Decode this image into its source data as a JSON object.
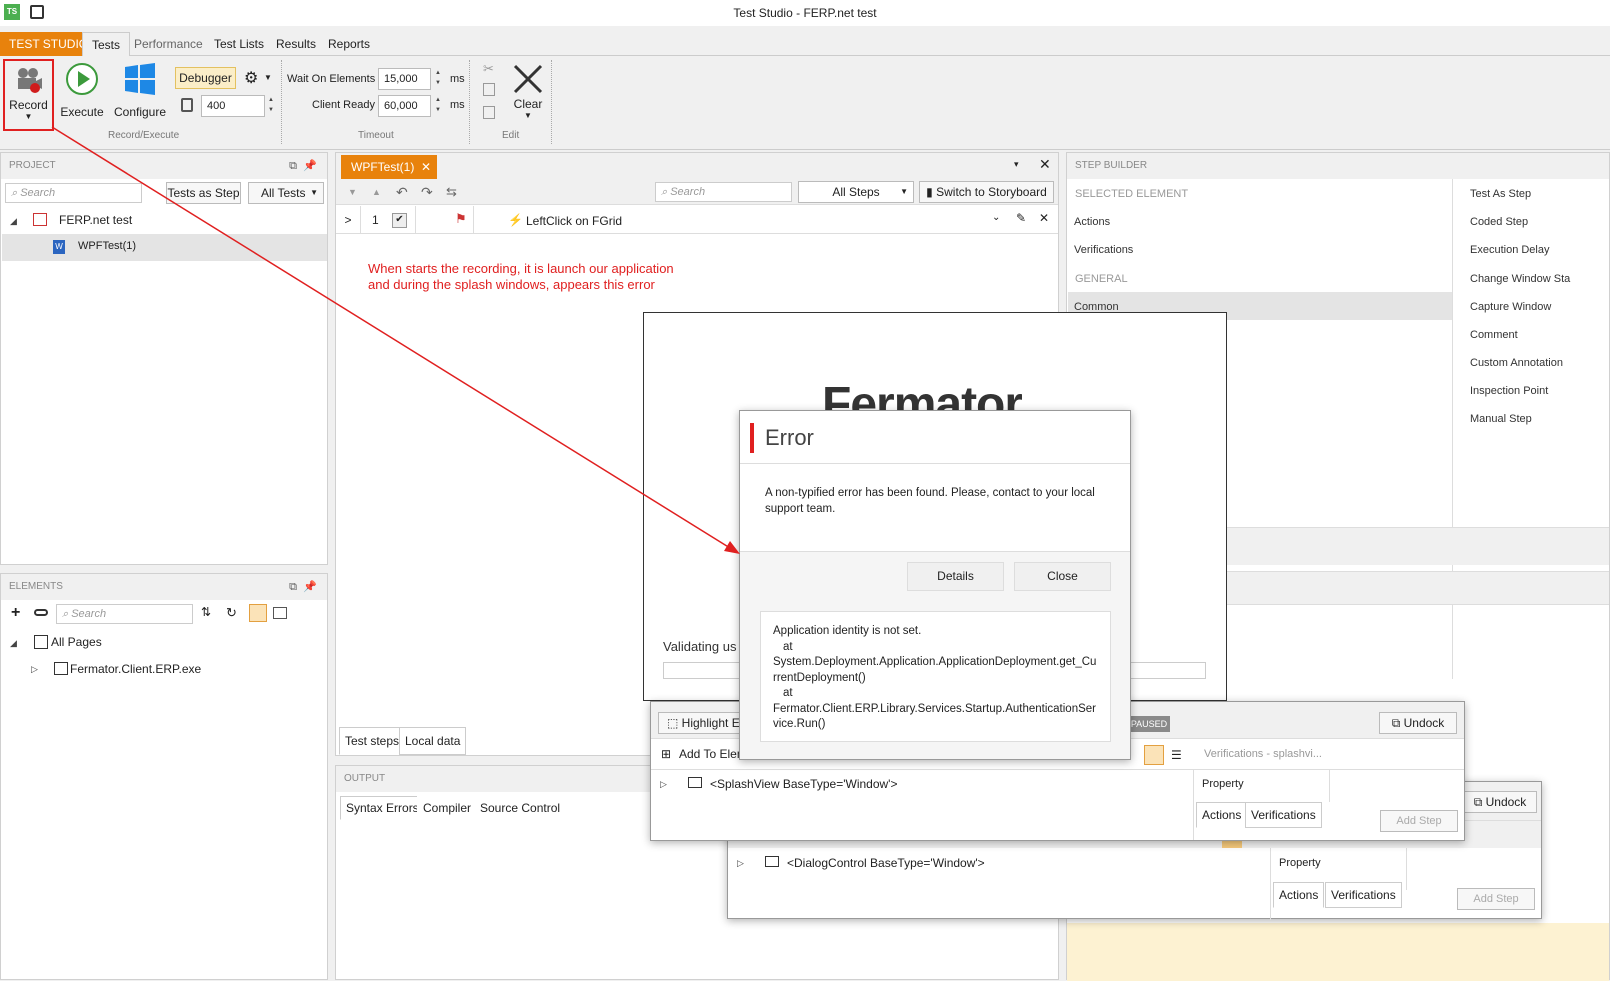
{
  "window": {
    "title": "Test Studio - FERP.net test"
  },
  "menu": {
    "brand": "TEST STUDIO",
    "items": [
      "Tests",
      "Performance",
      "Test Lists",
      "Results",
      "Reports"
    ]
  },
  "ribbon": {
    "record": "Record",
    "execute": "Execute",
    "configure": "Configure",
    "debugger": "Debugger",
    "delay_value": "400",
    "group_record": "Record/Execute",
    "wait_label": "Wait On Elements",
    "wait_value": "15,000",
    "wait_unit": "ms",
    "client_label": "Client Ready",
    "client_value": "60,000",
    "client_unit": "ms",
    "group_timeout": "Timeout",
    "clear": "Clear",
    "group_edit": "Edit"
  },
  "project": {
    "title": "PROJECT",
    "search_placeholder": "Search",
    "tests_as_step": "Tests as Step",
    "all_tests": "All Tests",
    "root": "FERP.net test",
    "child": "WPFTest(1)"
  },
  "elements": {
    "title": "ELEMENTS",
    "search_placeholder": "Search",
    "root": "All Pages",
    "child": "Fermator.Client.ERP.exe"
  },
  "editor": {
    "tab": "WPFTest(1)",
    "search_placeholder": "Search",
    "filter": "All Steps",
    "storyboard": "Switch to Storyboard",
    "step_num": "1",
    "step_text": "LeftClick on FGrid",
    "annotation": "When starts the recording, it is launch our application and during the splash windows, appears this error",
    "bottom_tabs": [
      "Test steps",
      "Local data"
    ]
  },
  "output": {
    "title": "OUTPUT",
    "tabs": [
      "Syntax Errors",
      "Compiler",
      "Source Control"
    ]
  },
  "step_builder": {
    "title": "STEP BUILDER",
    "selected": "SELECTED ELEMENT",
    "actions": "Actions",
    "verifications": "Verifications",
    "general": "GENERAL",
    "common": "Common",
    "right_items": [
      "Test As Step",
      "Coded Step",
      "Execution Delay",
      "Change Window Sta",
      "Capture Window",
      "Comment",
      "Custom Annotation",
      "Inspection Point",
      "Manual Step"
    ]
  },
  "splash": {
    "logo": "Fermator",
    "status": "Validating us"
  },
  "error": {
    "title": "Error",
    "message": "A non-typified error has been found. Please, contact to your local support team.",
    "details": "Details",
    "close": "Close",
    "trace_1": "Application identity is not set.",
    "trace_2": "at",
    "trace_3": "System.Deployment.Application.ApplicationDeployment.get_CurrentDeployment()",
    "trace_4": "at",
    "trace_5": "Fermator.Client.ERP.Library.Services.Startup.AuthenticationService.Run()"
  },
  "recorder1": {
    "highlight": "Highlight E",
    "paused": "PAUSED",
    "undock": "Undock",
    "add_to": "Add To Elem",
    "verif_header": "Verifications - splashvi...",
    "node": "<SplashView BaseType='Window'>",
    "property": "Property",
    "actions": "Actions",
    "verifications": "Verifications",
    "add_step": "Add Step"
  },
  "recorder2": {
    "undock": "Undock",
    "node": "<DialogControl BaseType='Window'>",
    "property": "Property",
    "actions": "Actions",
    "verifications": "Verifications",
    "add_step": "Add Step"
  }
}
